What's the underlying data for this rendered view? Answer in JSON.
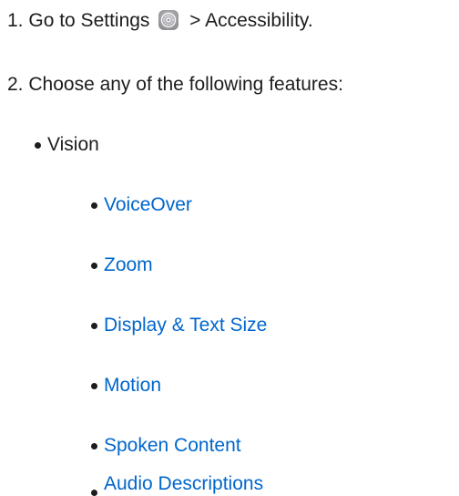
{
  "steps": [
    {
      "number": "1.",
      "text_before_icon": "Go to Settings",
      "text_after_icon": "> Accessibility.",
      "icon": "settings-gear-icon"
    },
    {
      "number": "2.",
      "text": "Choose any of the following features:"
    }
  ],
  "category": {
    "label": "Vision"
  },
  "features": [
    {
      "label": "VoiceOver"
    },
    {
      "label": "Zoom"
    },
    {
      "label": "Display & Text Size"
    },
    {
      "label": "Motion"
    },
    {
      "label": "Spoken Content"
    },
    {
      "label": "Audio Descriptions"
    }
  ],
  "colors": {
    "text": "#1d1d1f",
    "link": "#0066cc",
    "icon_gray": "#8e8e93"
  }
}
